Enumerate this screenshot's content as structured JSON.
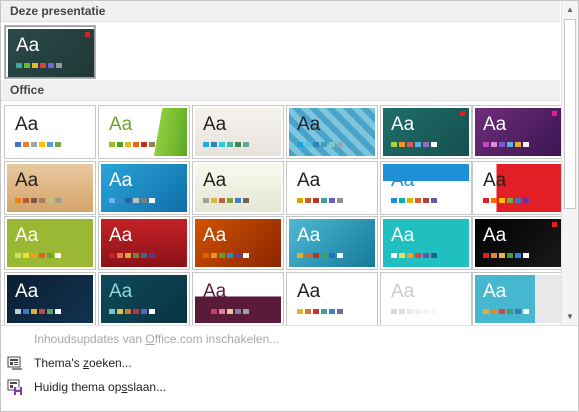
{
  "sections": {
    "current": "Deze presentatie",
    "office": "Office"
  },
  "themes": [
    {
      "name": "current",
      "bg": "linear-gradient(135deg,#2c4a48,#1f3836)",
      "fg": "#ffffff",
      "accent": "#e02020",
      "swatches": [
        "#3aa7a0",
        "#5bbf3a",
        "#e6b830",
        "#e0413a",
        "#6b6bd6",
        "#9a9a9a"
      ]
    },
    {
      "name": "office-theme",
      "bg": "#ffffff",
      "fg": "#222222",
      "swatches": [
        "#4472c4",
        "#ed7d31",
        "#a5a5a5",
        "#ffc000",
        "#5b9bd5",
        "#70ad47"
      ]
    },
    {
      "name": "facet",
      "bg": "linear-gradient(100deg,#ffffff 65%,#8fce3c 65%,#5ea826)",
      "fg": "#6aa62c",
      "swatches": [
        "#90c226",
        "#54a021",
        "#e6b91e",
        "#e76618",
        "#c42f1a",
        "#918655"
      ]
    },
    {
      "name": "integral",
      "bg": "linear-gradient(180deg,#f5f2ee,#e8e2dc)",
      "fg": "#222222",
      "swatches": [
        "#1cade4",
        "#2683c6",
        "#27ced7",
        "#42ba97",
        "#3e8853",
        "#62a39f"
      ]
    },
    {
      "name": "ion-boardroom",
      "bg": "repeating-linear-gradient(45deg,#4aa3c8 0 6px,#7ec6e0 6px 12px)",
      "fg": "#222222",
      "swatches": [
        "#1ca1d8",
        "#53c4e0",
        "#2d83b5",
        "#3fa3b2",
        "#7bcbc7",
        "#93a8b5"
      ]
    },
    {
      "name": "ion",
      "bg": "linear-gradient(135deg,#1f6e6a,#15504e)",
      "fg": "#ffffff",
      "accent": "#e02020",
      "swatches": [
        "#b0d23f",
        "#f29726",
        "#e15a5a",
        "#5db1e0",
        "#9b67c1",
        "#ffffff"
      ]
    },
    {
      "name": "organic",
      "bg": "linear-gradient(135deg,#6f2d7a,#3b1550)",
      "fg": "#ffffff",
      "accent": "#e02090",
      "swatches": [
        "#c04bc1",
        "#e08ad8",
        "#7b5bd0",
        "#5ab4e0",
        "#e0b030",
        "#f0f0f0"
      ]
    },
    {
      "name": "retrospect",
      "bg": "linear-gradient(180deg,#e8c9a0,#d6a36a)",
      "fg": "#222222",
      "swatches": [
        "#e48312",
        "#bd582c",
        "#865640",
        "#9b8357",
        "#c2bc80",
        "#94a088"
      ]
    },
    {
      "name": "savon",
      "bg": "linear-gradient(135deg,#2aa4d8,#0f6fa8)",
      "fg": "#ffffff",
      "swatches": [
        "#6fb4e2",
        "#3a85c5",
        "#2b5fa3",
        "#c0c0c0",
        "#7a7a7a",
        "#ffffff"
      ]
    },
    {
      "name": "slice",
      "bg": "linear-gradient(180deg,#f8f8ee,#e6e6d4)",
      "fg": "#222222",
      "swatches": [
        "#a0a0a0",
        "#d8b840",
        "#c06040",
        "#80a040",
        "#4080c0",
        "#706050"
      ]
    },
    {
      "name": "wisp",
      "bg": "#ffffff",
      "fg": "#222222",
      "swatches": [
        "#e0a000",
        "#d06020",
        "#c03030",
        "#40a0a0",
        "#6060c0",
        "#909090"
      ]
    },
    {
      "name": "banded",
      "bg": "linear-gradient(180deg,#1e90d8 0 35%,#ffffff 35%)",
      "fg": "#1e90d8",
      "swatches": [
        "#1e90d8",
        "#0ab0a0",
        "#e0b000",
        "#e06030",
        "#b04040",
        "#6060a0"
      ]
    },
    {
      "name": "berlin",
      "bg": "linear-gradient(90deg,#ffffff 25%,#e31e24 25%)",
      "fg": "#222222",
      "swatches": [
        "#e31e24",
        "#ff6a00",
        "#ffc000",
        "#70ad47",
        "#4472c4",
        "#7030a0"
      ]
    },
    {
      "name": "circuit",
      "bg": "#9ab833",
      "fg": "#ffffff",
      "swatches": [
        "#d0e060",
        "#f0e020",
        "#f0a020",
        "#e06020",
        "#70a030",
        "#ffffff"
      ]
    },
    {
      "name": "damask",
      "bg": "linear-gradient(180deg,#c32227,#8b1218)",
      "fg": "#ffffff",
      "swatches": [
        "#c32227",
        "#e07b39",
        "#d4a83a",
        "#6a8a3a",
        "#3a6a8a",
        "#5a3a8a"
      ]
    },
    {
      "name": "depth",
      "bg": "linear-gradient(135deg,#d15400,#8a2400)",
      "fg": "#ffffff",
      "swatches": [
        "#e06000",
        "#f09020",
        "#60a030",
        "#2090c0",
        "#6040a0",
        "#ffffff"
      ]
    },
    {
      "name": "dividend",
      "bg": "linear-gradient(135deg,#4fb9d6,#137a98)",
      "fg": "#ffffff",
      "swatches": [
        "#e0b020",
        "#e06020",
        "#c03030",
        "#40a060",
        "#2070c0",
        "#ffffff"
      ]
    },
    {
      "name": "droplet",
      "bg": "#20c0c0",
      "fg": "#ffffff",
      "swatches": [
        "#ffffff",
        "#e0e060",
        "#f0a030",
        "#e04040",
        "#7050b0",
        "#206090"
      ]
    },
    {
      "name": "frame",
      "bg": "linear-gradient(135deg,#000000,#1a1a1a)",
      "fg": "#ffffff",
      "accent": "#e02020",
      "swatches": [
        "#e02020",
        "#f08030",
        "#e0c030",
        "#40a040",
        "#3080e0",
        "#ffffff"
      ]
    },
    {
      "name": "gallery",
      "bg": "linear-gradient(135deg,#0a1f33,#12324f)",
      "fg": "#ffffff",
      "swatches": [
        "#b0d0e0",
        "#3080c0",
        "#e0b030",
        "#d04040",
        "#60a060",
        "#ffffff"
      ]
    },
    {
      "name": "mesh",
      "bg": "linear-gradient(135deg,#0d4a5a,#0a3340)",
      "fg": "#8fd6e0",
      "swatches": [
        "#6cc4d4",
        "#e0c040",
        "#e07030",
        "#c03040",
        "#6060c0",
        "#ffffff"
      ]
    },
    {
      "name": "parcel",
      "bg": "linear-gradient(180deg,#ffffff 45%,#5a1a3a 45%)",
      "fg": "#5a1a3a",
      "swatches": [
        "#5a1a3a",
        "#c04070",
        "#e08090",
        "#f0c0a0",
        "#8080a0",
        "#a0a0a0"
      ]
    },
    {
      "name": "quotable",
      "bg": "#ffffff",
      "fg": "#222222",
      "swatches": [
        "#e8b030",
        "#e07030",
        "#d03030",
        "#40a090",
        "#4080c0",
        "#8060a0"
      ]
    },
    {
      "name": "savon2",
      "bg": "#ffffff",
      "fg": "#cccccc",
      "swatches": [
        "#d8d8d8",
        "#e0e0e0",
        "#eaeaea",
        "#f0f0f0",
        "#f4f4f4",
        "#f8f8f8"
      ]
    },
    {
      "name": "view",
      "bg": "linear-gradient(90deg,#45b8d0 70%,#e8e8e8 70%)",
      "fg": "#ffffff",
      "swatches": [
        "#e0b030",
        "#f08030",
        "#e04040",
        "#40a060",
        "#4070c0",
        "#ffffff"
      ]
    }
  ],
  "thumb_text": "Aa",
  "menu": {
    "updates": {
      "pre": "Inhoudsupdates van ",
      "u": "O",
      "post": "ffice.com inschakelen..."
    },
    "search": {
      "pre": "Thema's ",
      "u": "z",
      "post": "oeken..."
    },
    "save": {
      "pre": "Huidig thema op",
      "u": "s",
      "post": "slaan..."
    }
  }
}
